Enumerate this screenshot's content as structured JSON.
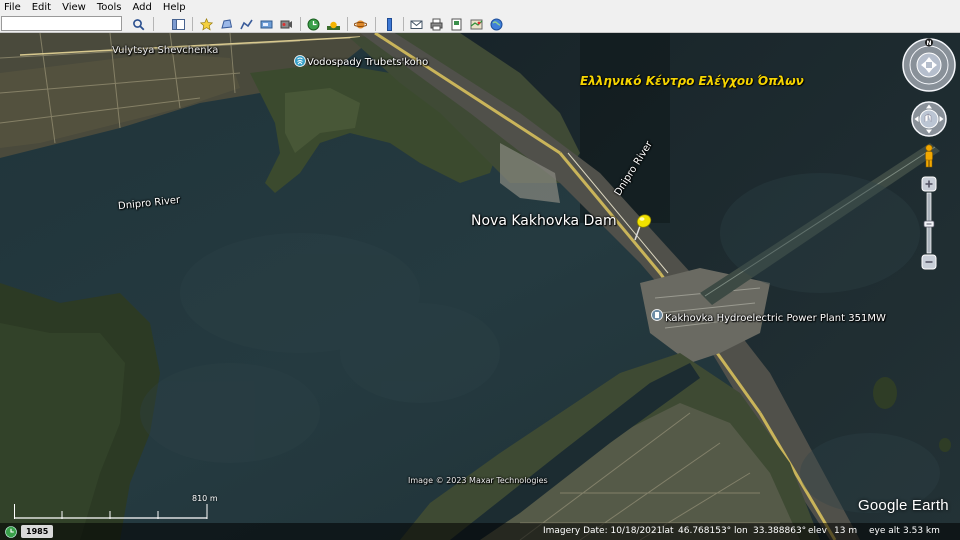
{
  "menu": {
    "items": [
      "File",
      "Edit",
      "View",
      "Tools",
      "Add",
      "Help"
    ]
  },
  "toolbar": {
    "search_value": "",
    "buttons": [
      "search-icon",
      "sidebar-icon",
      "placemark-icon",
      "polygon-icon",
      "path-icon",
      "overlay-icon",
      "tour-icon",
      "history-icon",
      "sun-icon",
      "planet-icon",
      "ruler-icon",
      "email-icon",
      "print-icon",
      "save-image-icon",
      "maps-icon",
      "earth-icon"
    ]
  },
  "map": {
    "labels": {
      "street": "Vulytsya Shevchenka",
      "waterfalls": "Vodospady Trubets'koho",
      "overlay_title": "Ελληνικό Κέντρο Ελέγχου Όπλων",
      "river_left": "Dnipro River",
      "river_right": "Dnipro River",
      "dam": "Nova Kakhovka Dam",
      "power_plant": "Kakhovka Hydroelectric Power Plant 351MW",
      "imagery_credit": "Image © 2023 Maxar Technologies"
    },
    "navigation": {
      "compass_north": "N"
    },
    "scale_label": "810 m",
    "logo": "Google Earth",
    "colors": {
      "water": "#22353a",
      "land": "#2e3a26",
      "dam_road": "#c9b45a",
      "overlay_text": "#f5d400"
    }
  },
  "statusbar": {
    "history_year": "1985",
    "imagery_date": "Imagery Date: 10/18/2021",
    "lat_label": "lat",
    "lat_value": "46.768153°",
    "lon_label": "lon",
    "lon_value": "33.388863°",
    "elev_label": "elev",
    "elev_value": "13 m",
    "eye_alt_label": "eye alt",
    "eye_alt_value": "3.53 km"
  }
}
